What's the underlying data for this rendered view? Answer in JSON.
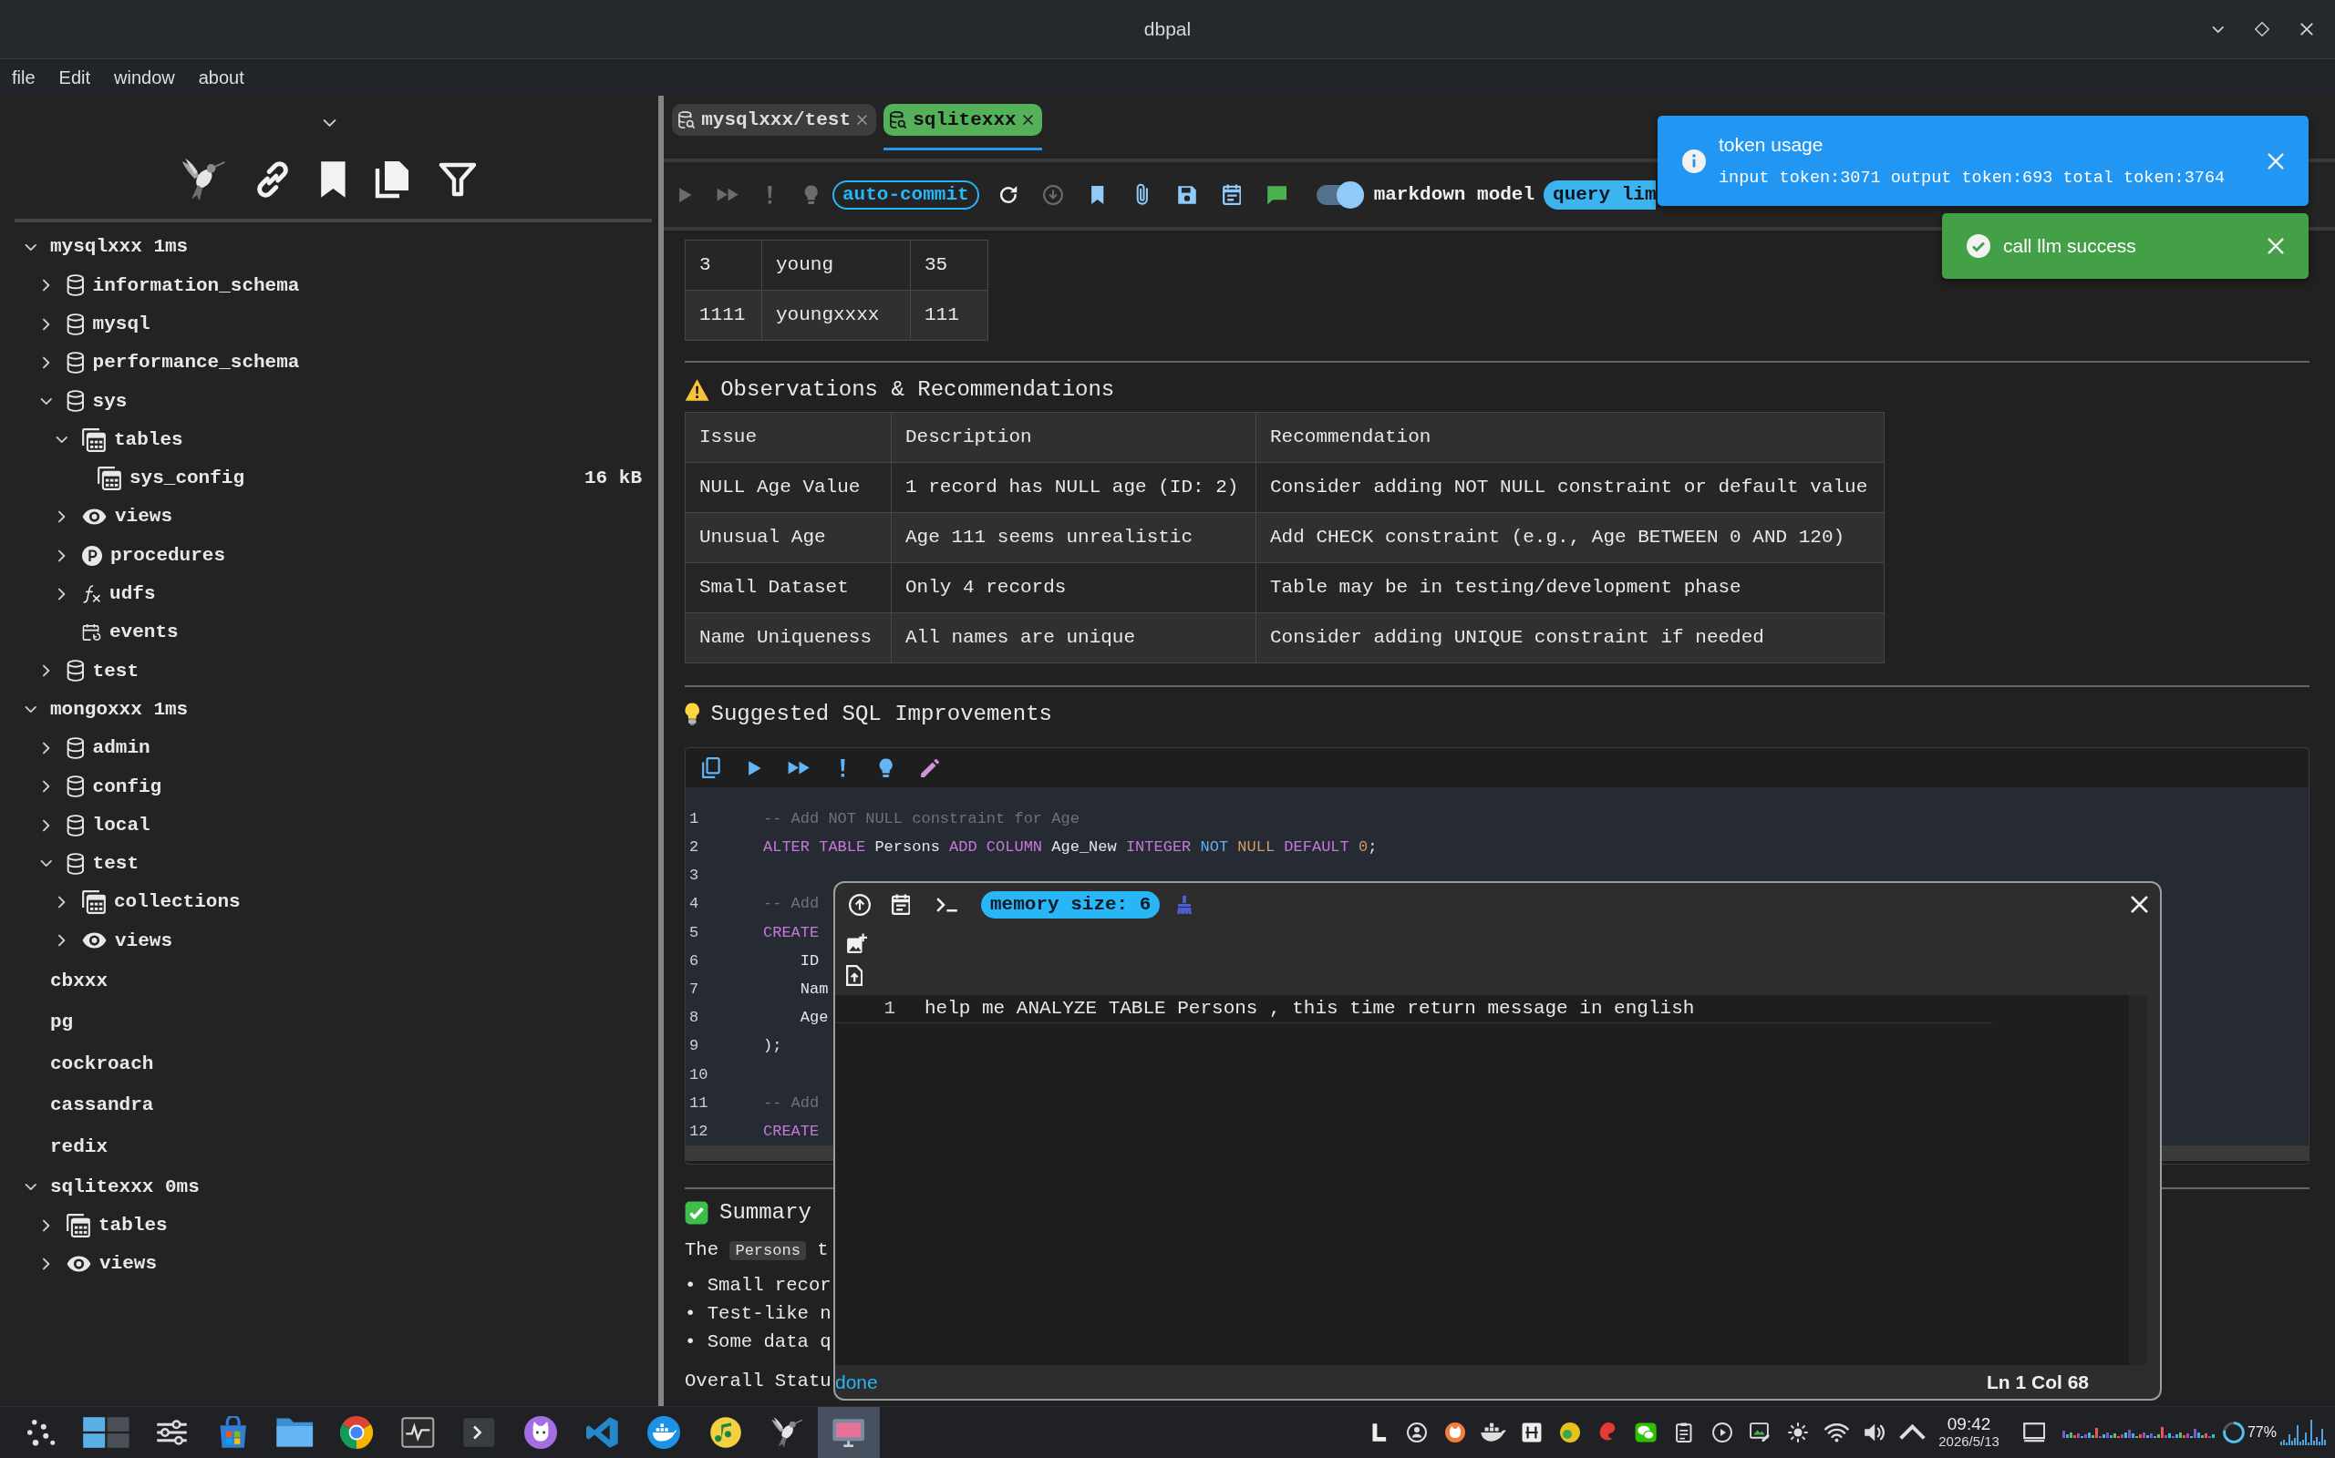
{
  "window": {
    "title": "dbpal"
  },
  "menu": [
    "file",
    "Edit",
    "window",
    "about"
  ],
  "sidebar": {
    "tree": [
      {
        "kind": "connection",
        "label": "mysqlxxx 1ms",
        "expanded": true,
        "children": [
          {
            "kind": "database",
            "label": "information_schema",
            "expanded": false
          },
          {
            "kind": "database",
            "label": "mysql",
            "expanded": false
          },
          {
            "kind": "database",
            "label": "performance_schema",
            "expanded": false
          },
          {
            "kind": "database",
            "label": "sys",
            "expanded": true,
            "children": [
              {
                "kind": "tables",
                "label": "tables",
                "expanded": true,
                "children": [
                  {
                    "kind": "table",
                    "label": "sys_config",
                    "size": "16 kB"
                  }
                ]
              },
              {
                "kind": "views",
                "label": "views",
                "expanded": false
              },
              {
                "kind": "procedures",
                "label": "procedures",
                "expanded": false
              },
              {
                "kind": "functions",
                "label": "udfs",
                "expanded": false
              },
              {
                "kind": "events",
                "label": "events"
              }
            ]
          },
          {
            "kind": "database",
            "label": "test",
            "expanded": false
          }
        ]
      },
      {
        "kind": "connection",
        "label": "mongoxxx 1ms",
        "expanded": true,
        "children": [
          {
            "kind": "database",
            "label": "admin",
            "expanded": false
          },
          {
            "kind": "database",
            "label": "config",
            "expanded": false
          },
          {
            "kind": "database",
            "label": "local",
            "expanded": false
          },
          {
            "kind": "database",
            "label": "test",
            "expanded": true,
            "children": [
              {
                "kind": "tables",
                "label": "collections",
                "expanded": false
              },
              {
                "kind": "views",
                "label": "views",
                "expanded": false
              }
            ]
          }
        ]
      },
      {
        "kind": "connection",
        "label": "cbxxx"
      },
      {
        "kind": "connection",
        "label": "pg"
      },
      {
        "kind": "connection",
        "label": "cockroach"
      },
      {
        "kind": "connection",
        "label": "cassandra"
      },
      {
        "kind": "connection",
        "label": "redix"
      },
      {
        "kind": "connection",
        "label": "sqlitexxx 0ms",
        "expanded": true,
        "children": [
          {
            "kind": "tables",
            "label": "tables",
            "expanded": false
          },
          {
            "kind": "views",
            "label": "views",
            "expanded": false
          }
        ]
      }
    ]
  },
  "tabs": [
    {
      "label": "mysqlxxx/test",
      "selected": false
    },
    {
      "label": "sqlitexxx",
      "selected": true
    }
  ],
  "toolbar": {
    "run_buttons": [
      {
        "kind": "run",
        "disabled": true
      },
      {
        "kind": "run_all",
        "disabled": true
      },
      {
        "kind": "explain",
        "disabled": true
      },
      {
        "kind": "suggest",
        "disabled": true
      }
    ],
    "auto_commit": "auto-commit",
    "tools": [
      {
        "kind": "refresh",
        "disabled": false
      },
      {
        "kind": "download",
        "disabled": true
      },
      {
        "kind": "bookmark",
        "disabled": false
      },
      {
        "kind": "attach",
        "disabled": false
      },
      {
        "kind": "save",
        "disabled": false
      },
      {
        "kind": "schedule",
        "disabled": false
      },
      {
        "kind": "chat",
        "disabled": false
      }
    ],
    "markdown": {
      "label": "markdown model",
      "on": true
    },
    "query_limit": "query lim"
  },
  "result": {
    "table": {
      "rows": [
        [
          "3",
          "young",
          "35"
        ],
        [
          "1111",
          "youngxxxx",
          "111"
        ]
      ]
    },
    "observations": {
      "title": "Observations & Recommendations",
      "columns": [
        "Issue",
        "Description",
        "Recommendation"
      ],
      "rows": [
        [
          "NULL Age Value",
          "1 record has NULL age (ID: 2)",
          "Consider adding NOT NULL constraint or default value"
        ],
        [
          "Unusual Age",
          "Age 111 seems unrealistic",
          "Add CHECK constraint (e.g., Age BETWEEN 0 AND 120)"
        ],
        [
          "Small Dataset",
          "Only 4 records",
          "Table may be in testing/development phase"
        ],
        [
          "Name Uniqueness",
          "All names are unique",
          "Consider adding UNIQUE constraint if needed"
        ]
      ]
    },
    "suggestions": {
      "title": "Suggested SQL Improvements",
      "actions": [
        {
          "kind": "copy",
          "disabled": false
        },
        {
          "kind": "run",
          "disabled": false
        },
        {
          "kind": "run_all",
          "disabled": false
        },
        {
          "kind": "explain",
          "disabled": false
        },
        {
          "kind": "suggest",
          "disabled": false
        },
        {
          "kind": "edit",
          "disabled": false
        }
      ],
      "lines": [
        {
          "number": "1",
          "tokens": [
            {
              "kind": "comment",
              "text": "-- Add NOT NULL constraint for Age"
            }
          ]
        },
        {
          "number": "2",
          "tokens": [
            {
              "kind": "keyword",
              "text": "ALTER TABLE"
            },
            {
              "kind": "plain",
              "text": "Persons"
            },
            {
              "kind": "keyword",
              "text": "ADD COLUMN"
            },
            {
              "kind": "plain",
              "text": "Age_New"
            },
            {
              "kind": "keyword",
              "text": "INTEGER"
            },
            {
              "kind": "operator",
              "text": "NOT"
            },
            {
              "kind": "constant",
              "text": "NULL"
            },
            {
              "kind": "keyword",
              "text": "DEFAULT"
            },
            {
              "kind": "constant",
              "text": "0"
            },
            {
              "kind": "punctuation",
              "text": ";"
            }
          ]
        },
        {
          "number": "3"
        },
        {
          "number": "4",
          "tokens": [
            {
              "kind": "comment",
              "text": "-- Add"
            }
          ]
        },
        {
          "number": "5",
          "tokens": [
            {
              "kind": "keyword",
              "text": "CREATE"
            }
          ]
        },
        {
          "number": "6",
          "tokens": [
            {
              "kind": "plain",
              "text": "    ID"
            }
          ]
        },
        {
          "number": "7",
          "tokens": [
            {
              "kind": "plain",
              "text": "    Nam"
            }
          ]
        },
        {
          "number": "8",
          "tokens": [
            {
              "kind": "plain",
              "text": "    Age"
            }
          ]
        },
        {
          "number": "9",
          "tokens": [
            {
              "kind": "plain",
              "text": ");"
            }
          ]
        },
        {
          "number": "10"
        },
        {
          "number": "11",
          "tokens": [
            {
              "kind": "comment",
              "text": "-- Add"
            }
          ]
        },
        {
          "number": "12",
          "tokens": [
            {
              "kind": "keyword",
              "text": "CREATE"
            }
          ]
        }
      ]
    },
    "summary": {
      "title": "Summary",
      "intro": [
        {
          "kind": "text",
          "text": "The"
        },
        {
          "kind": "code",
          "text": "Persons"
        },
        {
          "kind": "text",
          "text": "t"
        }
      ],
      "bullets": [
        "• Small recor",
        "• Test-like n",
        "• Some data q"
      ],
      "closing": "Overall Statu"
    }
  },
  "chat": {
    "memory": "memory size: 6",
    "lines": [
      {
        "number": "1",
        "text": "help me ANALYZE TABLE Persons , this time return message in english"
      }
    ],
    "status": "done",
    "cursor": "Ln 1 Col 68"
  },
  "toasts": [
    {
      "kind": "info",
      "title": "token usage",
      "message": "input token:3071 output token:693 total token:3764"
    },
    {
      "kind": "success",
      "title": "call llm success"
    }
  ],
  "taskbar": {
    "apps": [
      {
        "kind": "launcher",
        "selected": false
      },
      {
        "kind": "pager",
        "selected": false
      },
      {
        "kind": "mixer",
        "selected": false
      },
      {
        "kind": "store",
        "selected": false
      },
      {
        "kind": "files",
        "selected": false
      },
      {
        "kind": "browser",
        "selected": false
      },
      {
        "kind": "monitor",
        "selected": false
      },
      {
        "kind": "terminal",
        "selected": false
      },
      {
        "kind": "cat",
        "selected": false
      },
      {
        "kind": "editor",
        "selected": false
      },
      {
        "kind": "whale",
        "selected": false
      },
      {
        "kind": "music",
        "selected": false
      },
      {
        "kind": "bird",
        "selected": false
      },
      {
        "kind": "capture",
        "selected": true
      }
    ],
    "time": "09:42",
    "date": "2026/5/13",
    "battery": "77%"
  }
}
